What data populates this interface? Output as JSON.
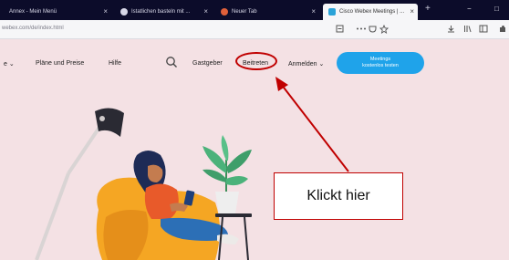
{
  "browser": {
    "tabs": [
      {
        "title": "Annex - Mein Menü"
      },
      {
        "title": "Istatlichen basteln mit ..."
      },
      {
        "title": "Neuer Tab"
      },
      {
        "title": "Cisco Webex Meetings | ..."
      }
    ],
    "tab_close": "×",
    "new_tab": "+",
    "url": "webex.com/de/index.html",
    "window_controls": {
      "minimize": "−",
      "maximize": "□"
    }
  },
  "site_nav": {
    "dropdown_fragment": "e ⌄",
    "plans": "Pläne und Preise",
    "help": "Hilfe",
    "host": "Gastgeber",
    "join": "Beitreten",
    "signin": "Anmelden ⌄",
    "cta_line1": "Meetings",
    "cta_line2": "kostenlos testen"
  },
  "annotation": {
    "callout_text": "Klickt hier",
    "color": "#c00000"
  },
  "colors": {
    "page_background": "#f4e1e4",
    "cta": "#1fa3ea",
    "tabbar": "#0c0c2a"
  }
}
